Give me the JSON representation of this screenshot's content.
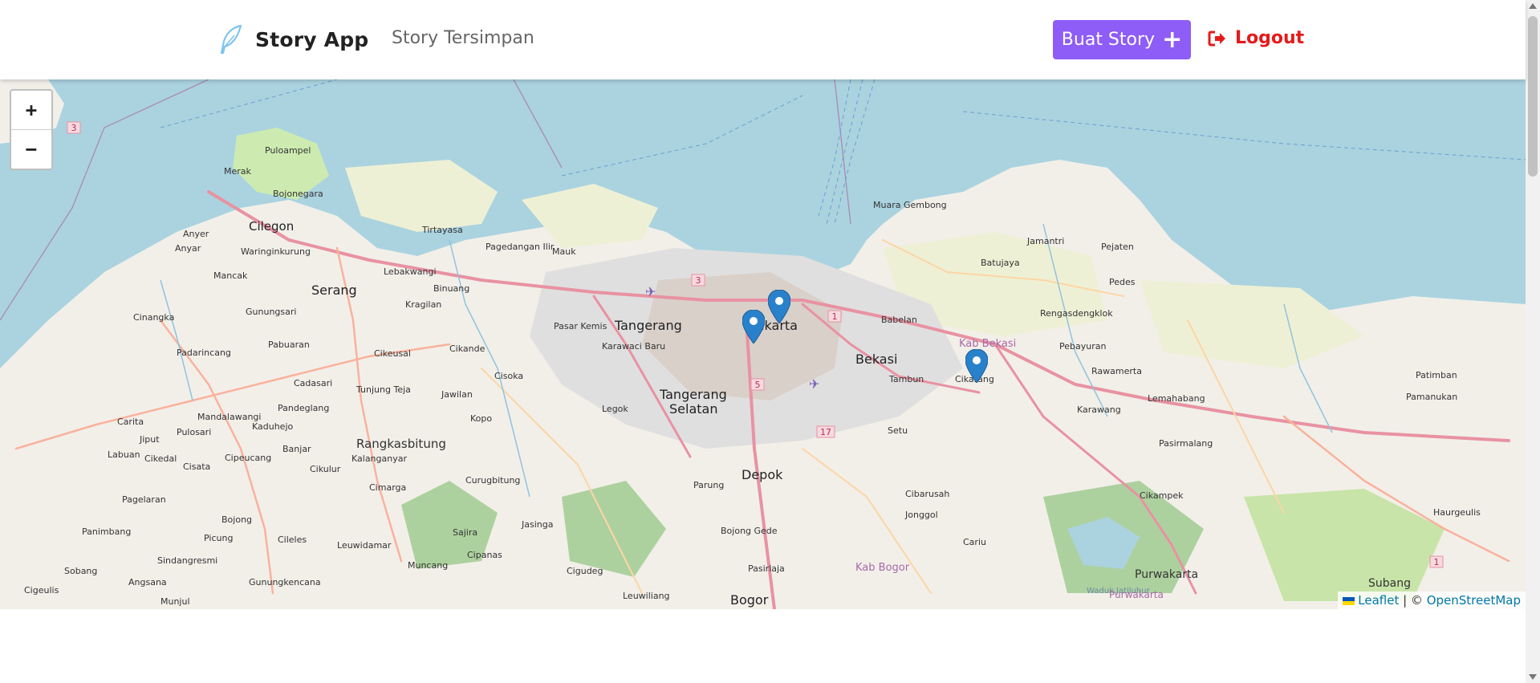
{
  "header": {
    "brand": "Story App",
    "nav_saved": "Story Tersimpan",
    "create_label": "Buat Story",
    "create_icon": "plus-icon",
    "logout_label": "Logout",
    "logout_icon": "sign-out-icon",
    "accent_color": "#8e5cf7",
    "logout_color": "#e41b1b"
  },
  "map": {
    "zoom_in": "+",
    "zoom_out": "−",
    "attribution_leaflet": "Leaflet",
    "attribution_sep": " | © ",
    "attribution_osm": "OpenStreetMap",
    "marker_icon": "map-marker-icon",
    "labels": {
      "cilegon": "Cilegon",
      "serang": "Serang",
      "tangerang": "Tangerang",
      "tangerang_selatan_1": "Tangerang",
      "tangerang_selatan_2": "Selatan",
      "jakarta": "Jakarta",
      "bekasi": "Bekasi",
      "kab_bekasi": "Kab Bekasi",
      "depok": "Depok",
      "bogor": "Bogor",
      "kab_bogor": "Kab Bogor",
      "cikarang": "Cikarang",
      "purwakarta": "Purwakarta",
      "subang": "Subang",
      "rangkasbitung": "Rangkasbitung",
      "karawang": "Karawang",
      "muara_gembong": "Muara Gembong",
      "pulo_ampel": "Puloampel",
      "merak": "Merak",
      "bojonegara": "Bojonegara",
      "anyer": "Anyer",
      "tirtayasa": "Tirtayasa",
      "pagedangan_ilir": "Pagedangan Ilir",
      "mauk": "Mauk",
      "binuang": "Binuang",
      "kragilan": "Kragilan",
      "pasar_kemis": "Pasar Kemis",
      "cikande": "Cikande",
      "cisoka": "Cisoka",
      "legok": "Legok",
      "parung": "Parung",
      "bojong_gede": "Bojong Gede",
      "cibarusah": "Cibarusah",
      "jonggol": "Jonggol",
      "setu": "Setu",
      "tambun": "Tambun",
      "babelan": "Babelan",
      "batujaya": "Batujaya",
      "jamantri": "Jamantri",
      "pejaten": "Pejaten",
      "pedes": "Pedes",
      "rengasdengklok": "Rengasdengklok",
      "pebayuran": "Pebayuran",
      "rawamerta": "Rawamerta",
      "lemahabang": "Lemahabang",
      "pasirmalang": "Pasirmalang",
      "cikampek": "Cikampek",
      "patimban": "Patimban",
      "pamanukan": "Pamanukan",
      "haurgeulis": "Haurgeulis",
      "karawaci": "Karawaci Baru",
      "curugbitung": "Curugbitung",
      "jasinga": "Jasinga",
      "cigudeg": "Cigudeg",
      "leuwiliang": "Leuwiliang",
      "pasirlaja": "Pasirlaja",
      "cariu": "Cariu",
      "sajira": "Sajira",
      "cipanas": "Cipanas",
      "muncang": "Muncang",
      "leuwidamar": "Leuwidamar",
      "cileles": "Cileles",
      "gunungkencana": "Gunungkencana",
      "bojong": "Bojong",
      "picung": "Picung",
      "panimbang": "Panimbang",
      "sobang": "Sobang",
      "angsana": "Angsana",
      "cigeulis": "Cigeulis",
      "munjul": "Munjul",
      "sindangresmi": "Sindangresmi",
      "labuan": "Labuan",
      "pagelaran": "Pagelaran",
      "carita": "Carita",
      "jiput": "Jiput",
      "cikedal": "Cikedal",
      "cisata": "Cisata",
      "cipeucang": "Cipeucang",
      "pulosari": "Pulosari",
      "mandalawangi": "Mandalawangi",
      "kaduhejo": "Kaduhejo",
      "banjar": "Banjar",
      "cikulur": "Cikulur",
      "kalanganyar": "Kalanganyar",
      "cimarga": "Cimarga",
      "padarincang": "Padarincang",
      "cinangka": "Cinangka",
      "pabuaran": "Pabuaran",
      "gunungsari": "Gunungsari",
      "mancak": "Mancak",
      "waringinkurung": "Waringinkurung",
      "anyar": "Anyar",
      "lebakwangi": "Lebakwangi",
      "cikeusal": "Cikeusal",
      "cadasari": "Cadasari",
      "pandeglang": "Pandeglang",
      "tunjung_teja": "Tunjung Teja",
      "jawilan": "Jawilan",
      "kopo": "Kopo",
      "wadukjatiluhur": "Waduk Jatiluhur",
      "purwakarta_sm": "Purwakarta",
      "karawang_sm": "Karawang",
      "pamanukan_sm": "Pamanukan"
    },
    "road_shields": [
      "3",
      "3",
      "1",
      "5",
      "17",
      "1"
    ]
  }
}
